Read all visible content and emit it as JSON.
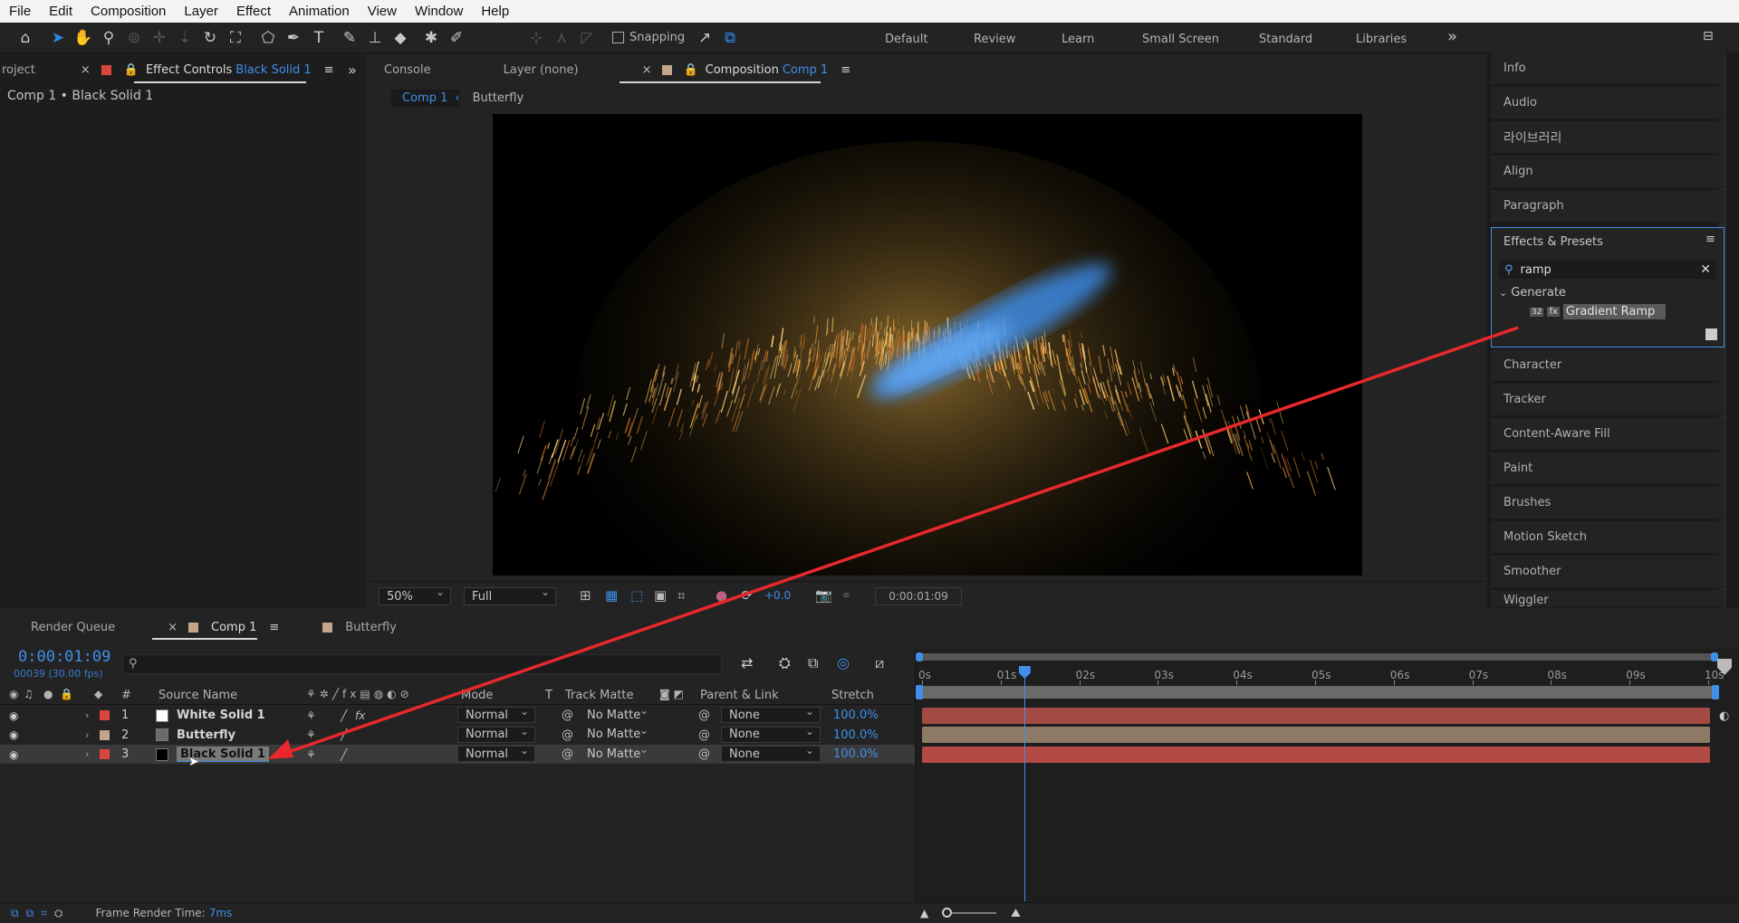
{
  "menu": [
    "File",
    "Edit",
    "Composition",
    "Layer",
    "Effect",
    "Animation",
    "View",
    "Window",
    "Help"
  ],
  "toolbar": {
    "snapping_label": "Snapping"
  },
  "workspaces": [
    "Default",
    "Review",
    "Learn",
    "Small Screen",
    "Standard",
    "Libraries"
  ],
  "left_panel": {
    "project_tab": "roject",
    "effect_controls_tab": "Effect Controls",
    "effect_controls_target": "Black Solid 1",
    "header": "Comp 1 • Black Solid 1"
  },
  "comp_panel": {
    "tabs": {
      "console": "Console",
      "layer": "Layer (none)",
      "composition": "Composition",
      "composition_name": "Comp 1"
    },
    "breadcrumbs": [
      "Comp 1",
      "Butterfly"
    ],
    "zoom": "50%",
    "resolution": "Full",
    "exposure": "+0.0",
    "timecode": "0:00:01:09"
  },
  "right_panel": {
    "items_top": [
      "Info",
      "Audio",
      "라이브러리",
      "Align",
      "Paragraph"
    ],
    "effects_presets": {
      "title": "Effects & Presets",
      "search_value": "ramp",
      "category": "Generate",
      "effect": "Gradient Ramp",
      "effect_badge": "32"
    },
    "items_bottom": [
      "Character",
      "Tracker",
      "Content-Aware Fill",
      "Paint",
      "Brushes",
      "Motion Sketch",
      "Smoother",
      "Wiggler"
    ]
  },
  "timeline": {
    "tabs": {
      "render_queue": "Render Queue",
      "comp": "Comp 1",
      "butterfly": "Butterfly"
    },
    "timecode": "0:00:01:09",
    "frame_info": "00039 (30.00 fps)",
    "columns": {
      "num": "#",
      "source": "Source Name",
      "mode": "Mode",
      "t": "T",
      "track_matte": "Track Matte",
      "parent": "Parent & Link",
      "stretch": "Stretch"
    },
    "layers": [
      {
        "num": "1",
        "name": "White Solid 1",
        "label_color": "#d9463e",
        "thumb_color": "#ffffff",
        "mode": "Normal",
        "matte": "No Matte",
        "parent": "None",
        "stretch": "100.0%",
        "bar_color": "#a34a44"
      },
      {
        "num": "2",
        "name": "Butterfly",
        "label_color": "#c2a58a",
        "thumb_color": "#6a6a6a",
        "mode": "Normal",
        "matte": "No Matte",
        "parent": "None",
        "stretch": "100.0%",
        "bar_color": "#8c7966"
      },
      {
        "num": "3",
        "name": "Black Solid 1",
        "label_color": "#d9463e",
        "thumb_color": "#000000",
        "mode": "Normal",
        "matte": "No Matte",
        "parent": "None",
        "stretch": "100.0%",
        "bar_color": "#b24a45"
      }
    ],
    "ruler": [
      "0s",
      "01s",
      "02s",
      "03s",
      "04s",
      "05s",
      "06s",
      "07s",
      "08s",
      "09s",
      "10s"
    ],
    "playhead_seconds": 1.3,
    "duration_seconds": 10
  },
  "statusbar": {
    "label": "Frame Render Time:",
    "value": "7ms"
  }
}
